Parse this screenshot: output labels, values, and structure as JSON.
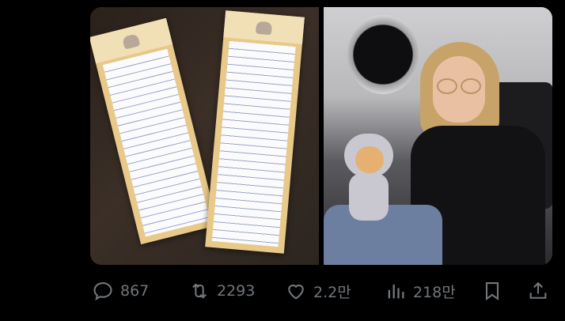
{
  "colors": {
    "background": "#000000",
    "action_gray": "#71767b"
  },
  "media": {
    "images": [
      {
        "icon": "handwritten-notes-photo"
      },
      {
        "icon": "astronaut-girl-photo"
      }
    ]
  },
  "actions": {
    "reply": {
      "icon": "reply-icon",
      "count": "867"
    },
    "retweet": {
      "icon": "retweet-icon",
      "count": "2293"
    },
    "like": {
      "icon": "heart-icon",
      "count": "2.2만"
    },
    "views": {
      "icon": "views-icon",
      "count": "218만"
    },
    "bookmark": {
      "icon": "bookmark-icon"
    },
    "share": {
      "icon": "share-icon"
    }
  }
}
